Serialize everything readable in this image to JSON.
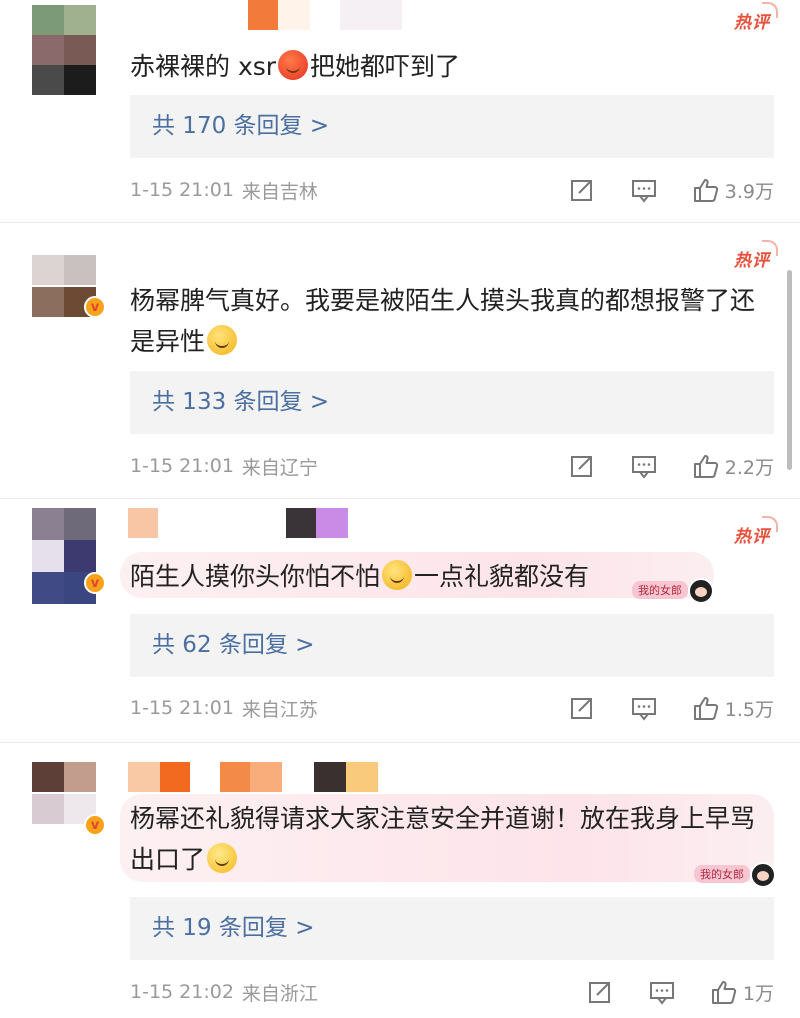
{
  "comments": [
    {
      "text_parts": [
        "赤裸裸的 xsr",
        "把她都吓到了"
      ],
      "emoji": "angry-face",
      "hot_label": "热评",
      "replies": "共 170 条回复 >",
      "date": "1-15 21:01",
      "location": "来自吉林",
      "likes": "3.9万",
      "verified": false
    },
    {
      "text_parts": [
        "杨幂脾气真好。我要是被陌生人摸头我真的都想报警了还是异性",
        ""
      ],
      "emoji": "sweat-face",
      "hot_label": "热评",
      "replies": "共 133 条回复 >",
      "date": "1-15 21:01",
      "location": "来自辽宁",
      "likes": "2.2万",
      "verified": true
    },
    {
      "text_parts": [
        "陌生人摸你头你怕不怕",
        "一点礼貌都没有"
      ],
      "emoji": "smirk-face",
      "hot_label": "热评",
      "sticker": "我的女郎",
      "replies": "共 62 条回复 >",
      "date": "1-15 21:01",
      "location": "来自江苏",
      "likes": "1.5万",
      "verified": true
    },
    {
      "text_parts": [
        "杨幂还礼貌得请求大家注意安全并道谢！放在我身上早骂出口了",
        ""
      ],
      "emoji": "smile-face",
      "sticker": "我的女郎",
      "replies": "共 19 条回复 >",
      "date": "1-15 21:02",
      "location": "来自浙江",
      "likes": "1万",
      "verified": true
    }
  ],
  "colors": {
    "link": "#4b6fa0",
    "hot": "#e8513d",
    "meta": "#9a9a9a",
    "reply_bg": "#f3f3f3"
  }
}
